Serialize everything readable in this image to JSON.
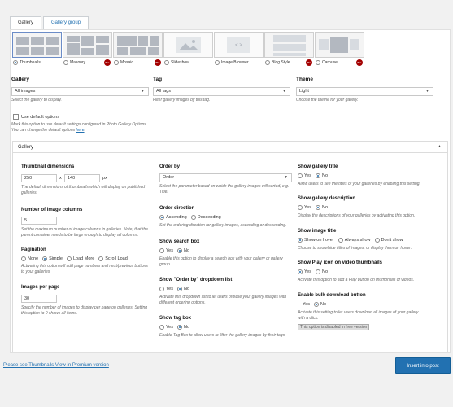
{
  "tabs": [
    {
      "label": "Gallery",
      "active": true
    },
    {
      "label": "Gallery group",
      "active": false
    }
  ],
  "views": [
    {
      "label": "Thumbnails",
      "selected": true,
      "pro": false,
      "icon": "thumbnails-view-icon"
    },
    {
      "label": "Masonry",
      "selected": false,
      "pro": true,
      "icon": "masonry-view-icon"
    },
    {
      "label": "Mosaic",
      "selected": false,
      "pro": true,
      "icon": "mosaic-view-icon"
    },
    {
      "label": "Slideshow",
      "selected": false,
      "pro": false,
      "icon": "slideshow-view-icon"
    },
    {
      "label": "Image Browser",
      "selected": false,
      "pro": false,
      "icon": "image-browser-view-icon"
    },
    {
      "label": "Blog Style",
      "selected": false,
      "pro": true,
      "icon": "blog-style-view-icon"
    },
    {
      "label": "Carousel",
      "selected": false,
      "pro": true,
      "icon": "carousel-view-icon"
    }
  ],
  "pro_badge": "Pro",
  "gallery": {
    "heading": "Gallery",
    "value": "All images",
    "desc": "Select the gallery to display."
  },
  "tag": {
    "heading": "Tag",
    "value": "All tags",
    "desc": "Filter gallery images by this tag."
  },
  "theme": {
    "heading": "Theme",
    "value": "Light",
    "desc": "Choose the theme for your gallery."
  },
  "default_options": {
    "label": "Use default options",
    "desc_line1": "Mark this option to use default settings configured in Photo Gallery Options.",
    "desc_line2_pre": "You can change the default options ",
    "desc_link": "here",
    "desc_line2_post": "."
  },
  "accordion": {
    "title": "Gallery",
    "toggle": "▲"
  },
  "col1": {
    "thumb_dim": {
      "heading": "Thumbnail dimensions",
      "width": "250",
      "sep": "x",
      "height": "140",
      "unit": "px",
      "desc_line1": "The default dimensions of thumbnails which will display on published",
      "desc_line2": "galleries."
    },
    "columns": {
      "heading": "Number of image columns",
      "value": "5",
      "desc_line1": "Set the maximum number of image columns in galleries. Note, that the",
      "desc_line2": "parent container needs to be large enough to display all columns."
    },
    "pagination": {
      "heading": "Pagination",
      "options": [
        "None",
        "Simple",
        "Load More",
        "Scroll Load"
      ],
      "selected": "Simple",
      "desc_line1": "Activating this option will add page numbers and next/previous buttons",
      "desc_line2": "to your galleries."
    },
    "per_page": {
      "heading": "Images per page",
      "value": "30",
      "desc_line1": "Specify the number of images to display per page on galleries. Setting",
      "desc_line2": "this option to 0 shows all items."
    }
  },
  "col2": {
    "order_by": {
      "heading": "Order by",
      "value": "Order",
      "desc_line1": "Select the parameter based on which the gallery images will sorted, e.g.",
      "desc_line2": "Title."
    },
    "order_dir": {
      "heading": "Order direction",
      "options": [
        "Ascending",
        "Descending"
      ],
      "selected": "Ascending",
      "desc": "Set the ordering direction for gallery images, ascending or descending."
    },
    "search_box": {
      "heading": "Show search box",
      "options": [
        "Yes",
        "No"
      ],
      "selected": "No",
      "desc_line1": "Enable this option to display a search box with your gallery or gallery",
      "desc_line2": "group."
    },
    "order_dropdown": {
      "heading": "Show \"Order by\" dropdown list",
      "options": [
        "Yes",
        "No"
      ],
      "selected": "No",
      "desc_line1": "Activate this dropdown list to let users browse your gallery images with",
      "desc_line2": "different ordering options."
    },
    "tag_box": {
      "heading": "Show tag box",
      "options": [
        "Yes",
        "No"
      ],
      "selected": "No",
      "desc": "Enable Tag Box to allow users to filter the gallery images by their tags."
    }
  },
  "col3": {
    "gallery_title": {
      "heading": "Show gallery title",
      "options": [
        "Yes",
        "No"
      ],
      "selected": "No",
      "desc": "Allow users to see the titles of your galleries by enabling this setting."
    },
    "gallery_desc": {
      "heading": "Show gallery description",
      "options": [
        "Yes",
        "No"
      ],
      "selected": "No",
      "desc": "Display the descriptions of your galleries by activating this option."
    },
    "image_title": {
      "heading": "Show image title",
      "options": [
        "Show on hover",
        "Always show",
        "Don't show"
      ],
      "selected": "Show on hover",
      "desc": "Choose to show/hide titles of images, or display them on hover."
    },
    "play_icon": {
      "heading": "Show Play icon on video thumbnails",
      "options": [
        "Yes",
        "No"
      ],
      "selected": "Yes",
      "desc": "Activate this option to add a Play button on thumbnails of videos."
    },
    "bulk_download": {
      "heading": "Enable bulk download button",
      "options": [
        "Yes",
        "No"
      ],
      "selected": "No",
      "desc_line1": "Activate this setting to let users download all images of your gallery",
      "desc_line2": "with a click.",
      "disabled_note": "This option is disabled in free version"
    }
  },
  "footer": {
    "premium_link": "Please see Thumbnails View in Premium version",
    "insert_button": "Insert into post"
  },
  "colors": {
    "accent": "#2271b1",
    "pro_badge": "#a30000"
  }
}
